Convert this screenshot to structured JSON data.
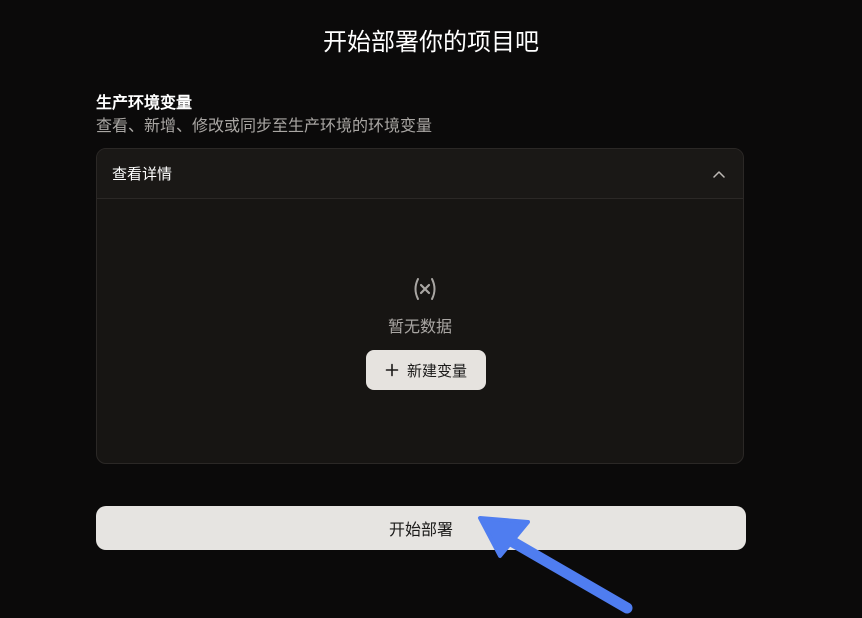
{
  "page": {
    "title": "开始部署你的项目吧"
  },
  "section": {
    "heading": "生产环境变量",
    "description": "查看、新增、修改或同步至生产环境的环境变量"
  },
  "panel": {
    "header_title": "查看详情",
    "header_icon": "chevron-up-icon",
    "empty_icon": "x-in-parentheses-icon",
    "empty_text": "暂无数据",
    "new_button_icon": "plus-icon",
    "new_button_label": "新建变量"
  },
  "deploy": {
    "button_label": "开始部署"
  },
  "annotation": {
    "icon": "pointer-arrow-icon",
    "color": "#4f7df0"
  },
  "colors": {
    "background": "#0b0a0a",
    "panel": "#171513",
    "button": "#e6e4e1",
    "muted_text": "#a9a6a3"
  }
}
